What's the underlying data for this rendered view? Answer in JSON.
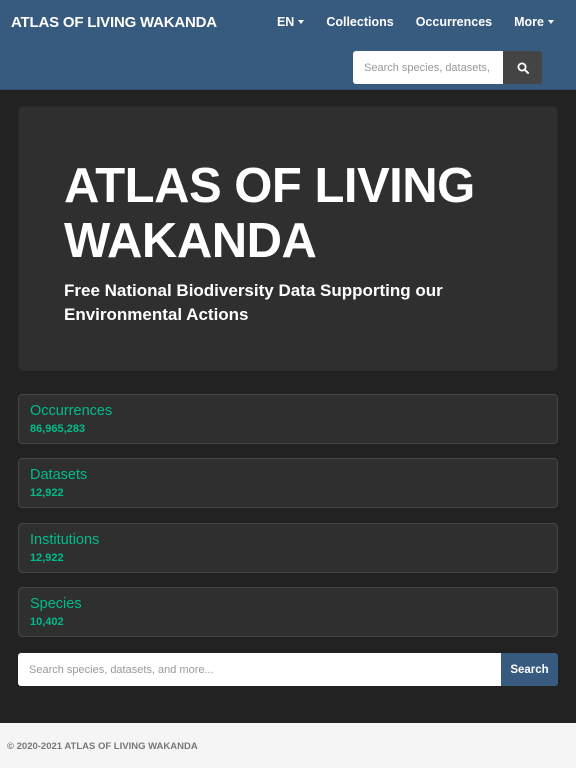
{
  "navbar": {
    "brand": "ATLAS OF LIVING WAKANDA",
    "language": "EN",
    "links": [
      "Collections",
      "Occurrences"
    ],
    "more_label": "More",
    "search_placeholder": "Search species, datasets, and more...",
    "search_icon": "search-icon",
    "background_color": "#375a7f"
  },
  "hero": {
    "title": "ATLAS OF LIVING WAKANDA",
    "subtitle": "Free National Biodiversity Data Supporting our Environmental Actions"
  },
  "stats": [
    {
      "label": "Occurrences",
      "count": "86,965,283"
    },
    {
      "label": "Datasets",
      "count": "12,922"
    },
    {
      "label": "Institutions",
      "count": "12,922"
    },
    {
      "label": "Species",
      "count": "10,402"
    }
  ],
  "search": {
    "placeholder": "Search species, datasets, and more...",
    "button_label": "Search"
  },
  "footer": {
    "copyright": "© 2020-2021 ATLAS OF LIVING WAKANDA"
  },
  "colors": {
    "accent": "#00bc8c",
    "primary": "#375a7f",
    "background": "#222222",
    "panel": "#2f2f2f"
  }
}
